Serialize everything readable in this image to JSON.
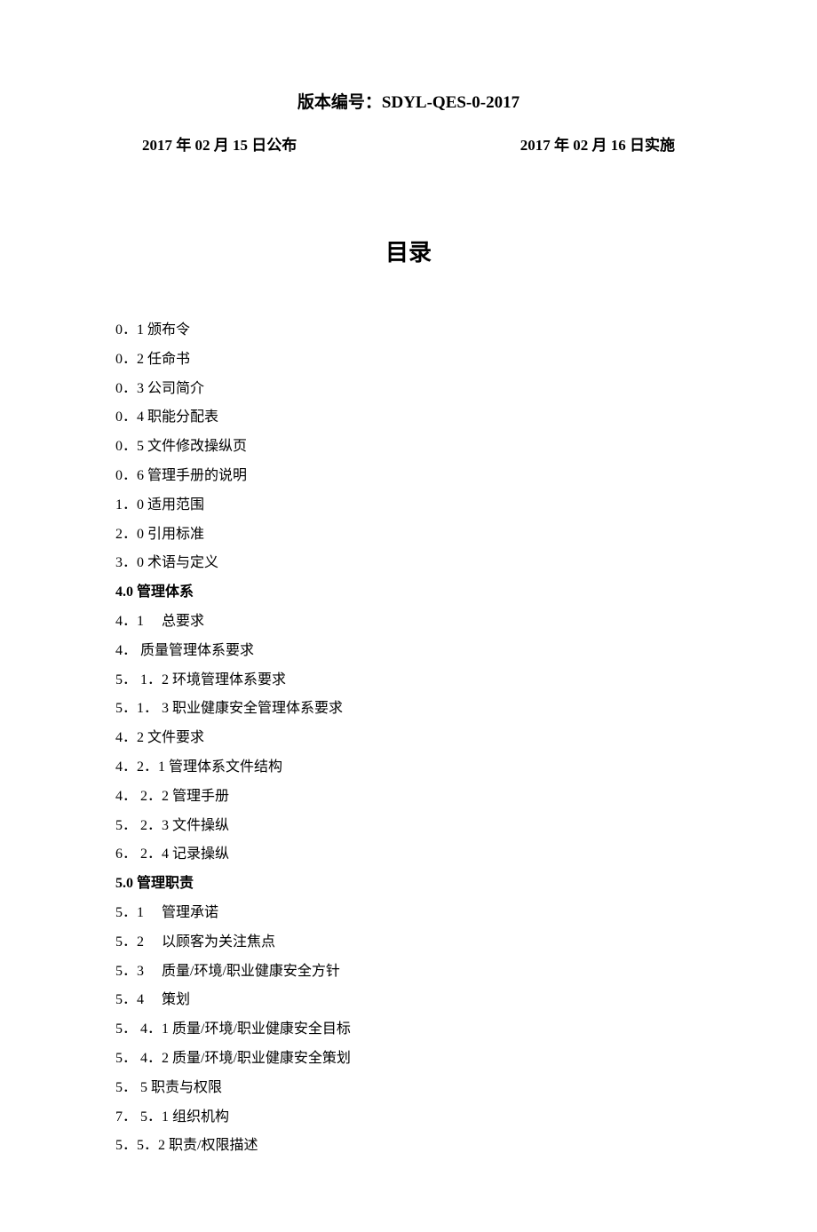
{
  "header": {
    "version_label": "版本编号：",
    "version_value": "SDYL-QES-0-2017",
    "publish_date": "2017 年 02 月 15 日公布",
    "effective_date": "2017 年 02 月 16 日实施"
  },
  "toc": {
    "title": "目录",
    "items": [
      {
        "text": "0．1 颁布令",
        "bold": false
      },
      {
        "text": "0．2 任命书",
        "bold": false
      },
      {
        "text": "0．3 公司简介",
        "bold": false
      },
      {
        "text": "0．4 职能分配表",
        "bold": false
      },
      {
        "text": "0．5 文件修改操纵页",
        "bold": false
      },
      {
        "text": "0．6 管理手册的说明",
        "bold": false
      },
      {
        "text": "1．0 适用范围",
        "bold": false
      },
      {
        "text": "2．0 引用标准",
        "bold": false
      },
      {
        "text": "3．0 术语与定义",
        "bold": false
      },
      {
        "text": "4.0 管理体系",
        "bold": true
      },
      {
        "text": "4．1　 总要求",
        "bold": false
      },
      {
        "text": "4． 质量管理体系要求",
        "bold": false
      },
      {
        "text": "5． 1．2 环境管理体系要求",
        "bold": false
      },
      {
        "text": "5．1． 3 职业健康安全管理体系要求",
        "bold": false
      },
      {
        "text": "4．2 文件要求",
        "bold": false
      },
      {
        "text": "4．2．1 管理体系文件结构",
        "bold": false
      },
      {
        "text": "4． 2．2 管理手册",
        "bold": false
      },
      {
        "text": "5． 2．3 文件操纵",
        "bold": false
      },
      {
        "text": "6． 2．4 记录操纵",
        "bold": false
      },
      {
        "text": "5.0 管理职责",
        "bold": true
      },
      {
        "text": "5．1　 管理承诺",
        "bold": false
      },
      {
        "text": "5．2　 以顾客为关注焦点",
        "bold": false
      },
      {
        "text": "5．3　 质量/环境/职业健康安全方针",
        "bold": false
      },
      {
        "text": "5．4　 策划",
        "bold": false
      },
      {
        "text": "5． 4．1 质量/环境/职业健康安全目标",
        "bold": false
      },
      {
        "text": "5． 4．2 质量/环境/职业健康安全策划",
        "bold": false
      },
      {
        "text": "5． 5 职责与权限",
        "bold": false
      },
      {
        "text": "7． 5．1 组织机构",
        "bold": false
      },
      {
        "text": "5．5．2 职责/权限描述",
        "bold": false
      }
    ]
  }
}
